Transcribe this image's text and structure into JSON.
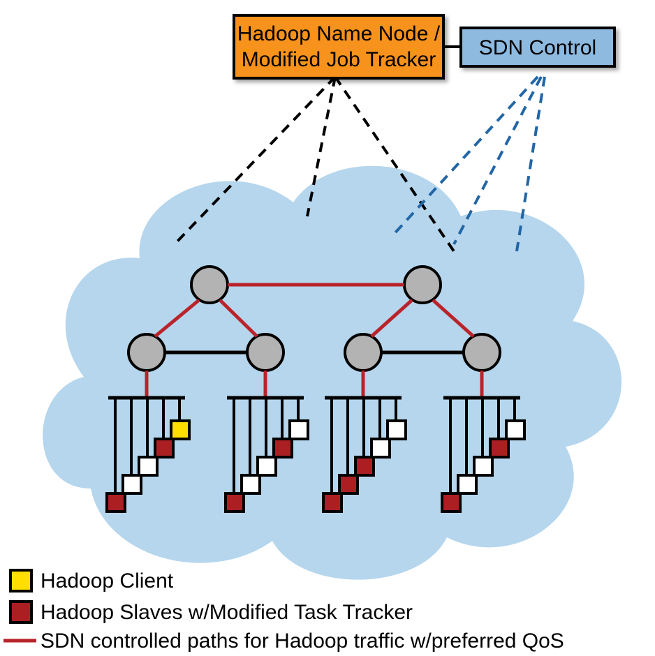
{
  "boxes": {
    "hadoop_line1": "Hadoop Name Node /",
    "hadoop_line2": "Modified Job Tracker",
    "sdn_label": "SDN Control"
  },
  "legend": {
    "client": "Hadoop Client",
    "slaves": "Hadoop Slaves w/Modified Task Tracker",
    "paths": "SDN controlled paths for Hadoop traffic w/preferred QoS"
  },
  "colors": {
    "orange": "#f7921e",
    "blue_box": "#8ebae0",
    "cloud": "#b5d6ed",
    "node_fill": "#b3b3b3",
    "red": "#ab1f23",
    "red_line": "#b9242a",
    "yellow": "#ffde00",
    "blue_dash": "#2266a6"
  }
}
